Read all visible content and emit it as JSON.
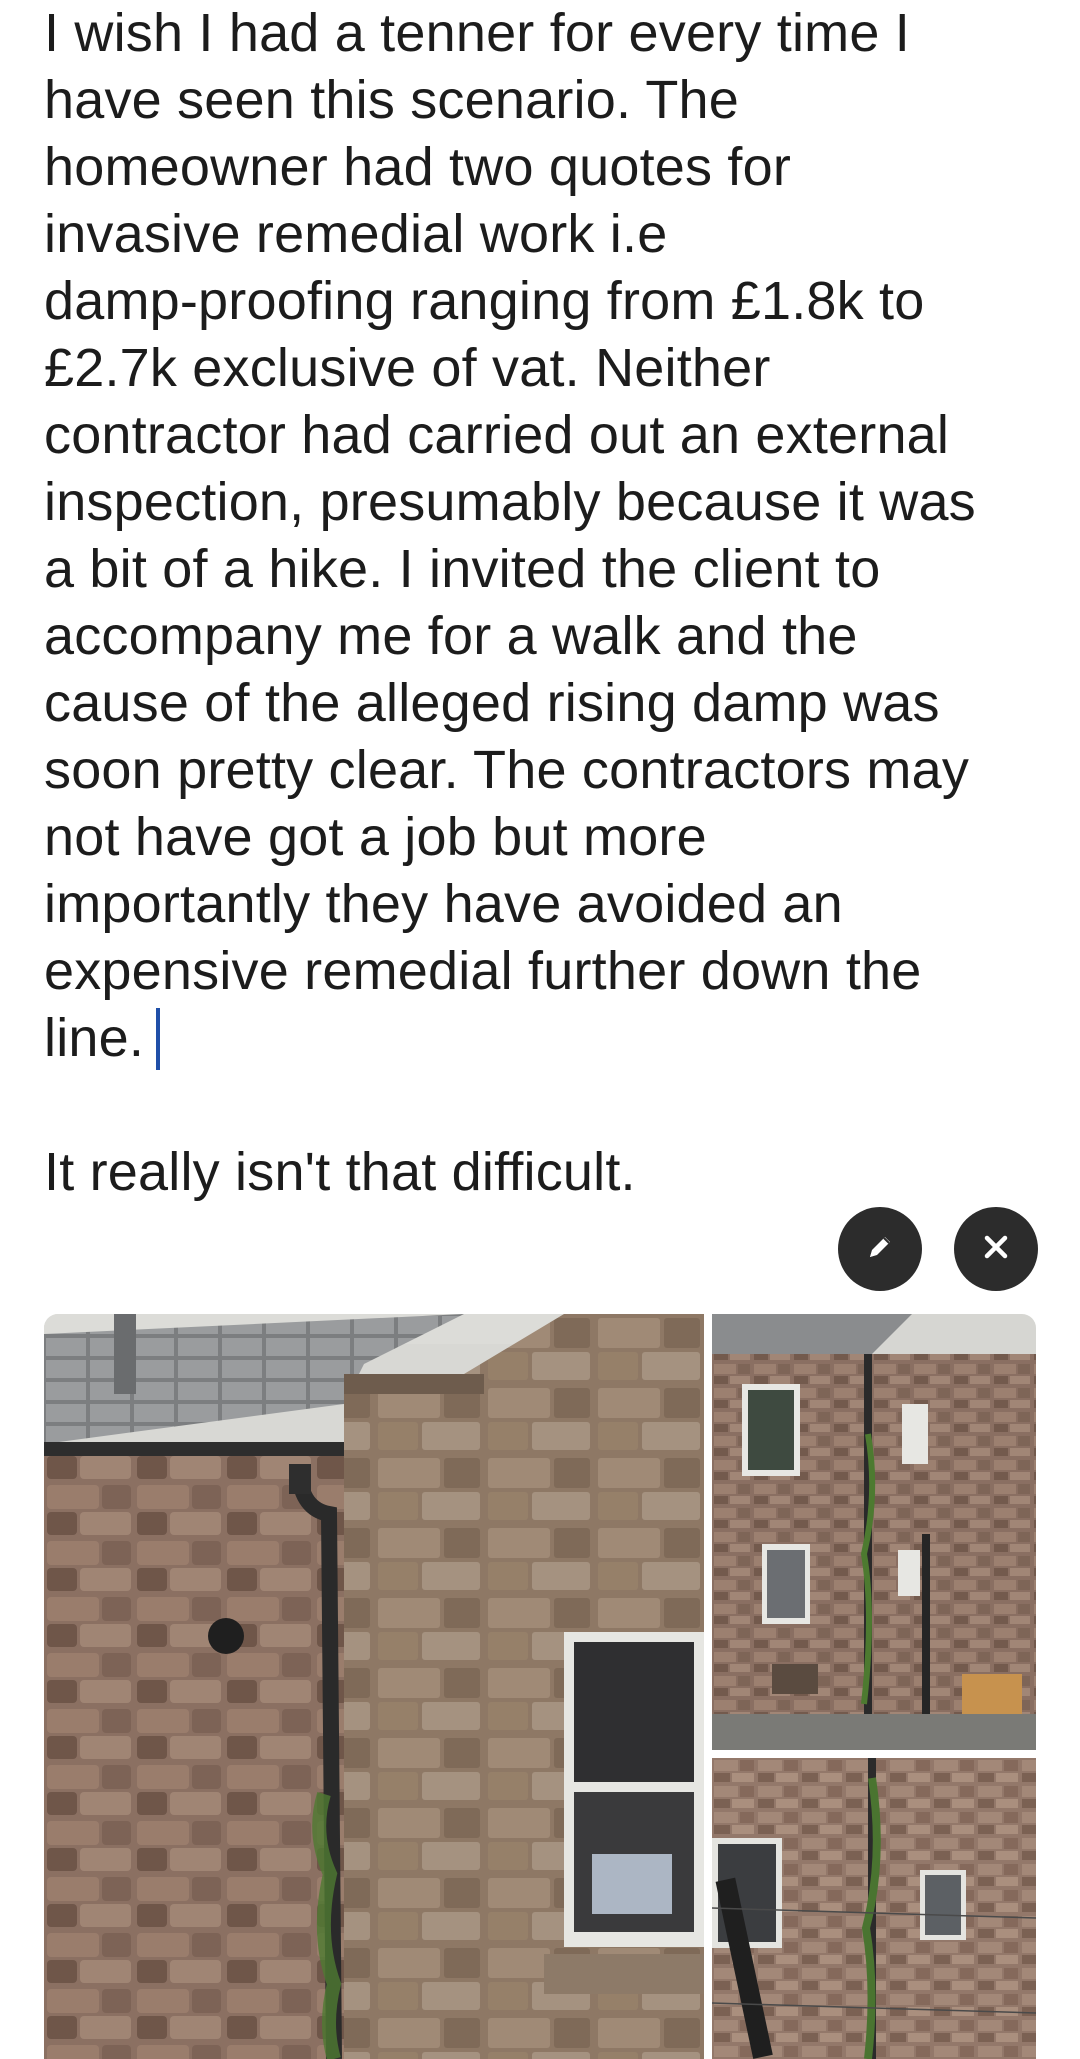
{
  "post": {
    "paragraph1_lines": [
      "I wish I had a tenner for every time I",
      "have seen this scenario. The",
      "homeowner had two quotes for",
      "invasive remedial work i.e",
      "damp-proofing ranging from £1.8k to",
      "£2.7k exclusive of vat. Neither",
      "contractor had carried out an external",
      "inspection, presumably because it was",
      "a bit of a hike. I invited the client to",
      "accompany me for a walk and the",
      "cause of the alleged rising damp was",
      "soon pretty clear. The contractors may",
      "not have got a job but more",
      "importantly they have avoided an",
      "expensive remedial further down the",
      "line."
    ],
    "paragraph2": "It really isn't that difficult."
  },
  "attachment_actions": {
    "edit_icon": "pencil-icon",
    "remove_icon": "close-icon",
    "button_color": "#2c2c2c"
  },
  "gallery": {
    "photos": [
      {
        "icon": "photo-stone-wall-downpipe"
      },
      {
        "icon": "photo-building-rear-elevation"
      },
      {
        "icon": "photo-building-wall-closeup"
      }
    ]
  },
  "colors": {
    "text": "#1c1c1c",
    "caret": "#1f4fa8",
    "stone": "#8a6f5e"
  }
}
